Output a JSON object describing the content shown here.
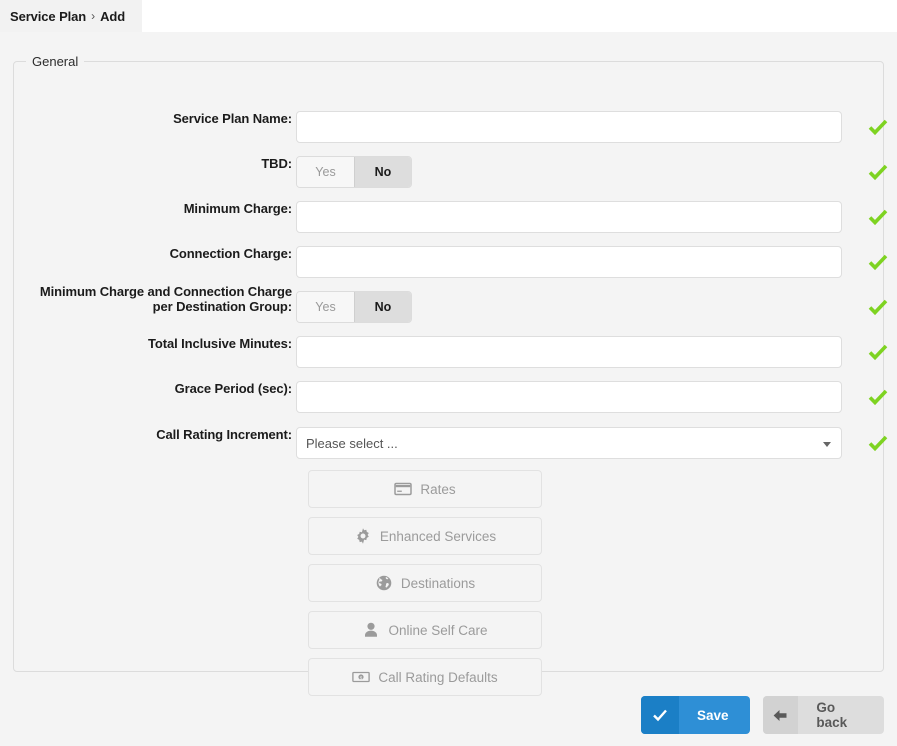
{
  "tab": {
    "parent": "Service Plan",
    "separator": "›",
    "current": "Add"
  },
  "fieldset": {
    "legend": "General"
  },
  "form": {
    "rows": [
      {
        "label": "Service Plan Name:",
        "type": "text",
        "value": "",
        "placeholder": "",
        "valid_icon": "check-icon"
      },
      {
        "label": "TBD:",
        "type": "toggle",
        "yes_label": "Yes",
        "no_label": "No",
        "selected": "No",
        "valid_icon": "check-icon"
      },
      {
        "label": "Minimum Charge:",
        "type": "text",
        "value": "",
        "placeholder": "",
        "valid_icon": "check-icon"
      },
      {
        "label": "Connection Charge:",
        "type": "text",
        "value": "",
        "placeholder": "",
        "valid_icon": "check-icon"
      },
      {
        "label": "Minimum Charge and Connection Charge per Destination Group:",
        "label_line1": "Minimum Charge and Connection Charge",
        "label_line2": "per Destination Group:",
        "type": "toggle",
        "yes_label": "Yes",
        "no_label": "No",
        "selected": "No",
        "valid_icon": "check-icon"
      },
      {
        "label": "Total Inclusive Minutes:",
        "type": "text",
        "value": "",
        "placeholder": "",
        "valid_icon": "check-icon"
      },
      {
        "label": "Grace Period (sec):",
        "type": "text",
        "value": "",
        "placeholder": "",
        "valid_icon": "check-icon"
      },
      {
        "label": "Call Rating Increment:",
        "type": "select",
        "value": "Please select ...",
        "valid_icon": "check-icon"
      }
    ]
  },
  "section_buttons": [
    {
      "label": "Rates",
      "icon": "credit-card-icon"
    },
    {
      "label": "Enhanced Services",
      "icon": "gear-icon"
    },
    {
      "label": "Destinations",
      "icon": "globe-icon"
    },
    {
      "label": "Online Self Care",
      "icon": "user-icon"
    },
    {
      "label": "Call Rating Defaults",
      "icon": "money-bill-icon"
    }
  ],
  "footer": {
    "save_label": "Save",
    "save_icon": "check-icon",
    "go_back_label": "Go back",
    "go_back_icon": "arrow-left-icon"
  },
  "colors": {
    "page_background": "#f4f4f4",
    "valid_check": "#7ed321",
    "save_button": "#2e8fd6",
    "save_button_icon": "#1b7fc6",
    "go_back_button": "#dddddd",
    "toggle_selected": "#dddddd"
  }
}
